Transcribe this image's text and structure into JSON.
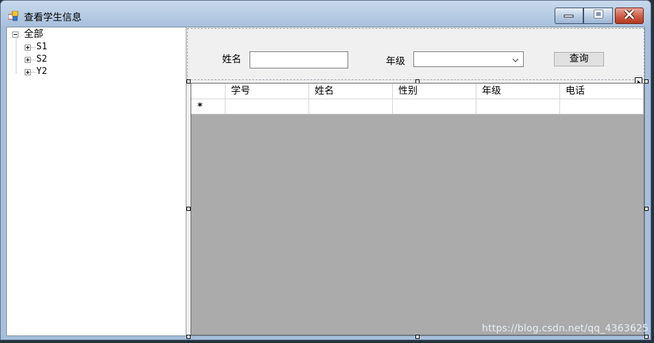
{
  "window": {
    "title": "查看学生信息",
    "icon": "form-icon"
  },
  "titlebar_buttons": {
    "minimize": "minimize-icon",
    "maximize": "maximize-icon",
    "close": "close-icon"
  },
  "tree": {
    "root": "全部",
    "children": [
      "S1",
      "S2",
      "Y2"
    ]
  },
  "search": {
    "name_label": "姓名",
    "name_value": "",
    "grade_label": "年级",
    "grade_selected": "",
    "query_button": "查询"
  },
  "grid": {
    "columns": [
      "学号",
      "姓名",
      "性别",
      "年级",
      "电话"
    ],
    "new_row_marker": "*"
  },
  "watermark": "https://blog.csdn.net/qq_4363625",
  "colors": {
    "grid_background": "#ababab",
    "close_button": "#cf5b43",
    "titlebar": "#a6bfdc"
  }
}
